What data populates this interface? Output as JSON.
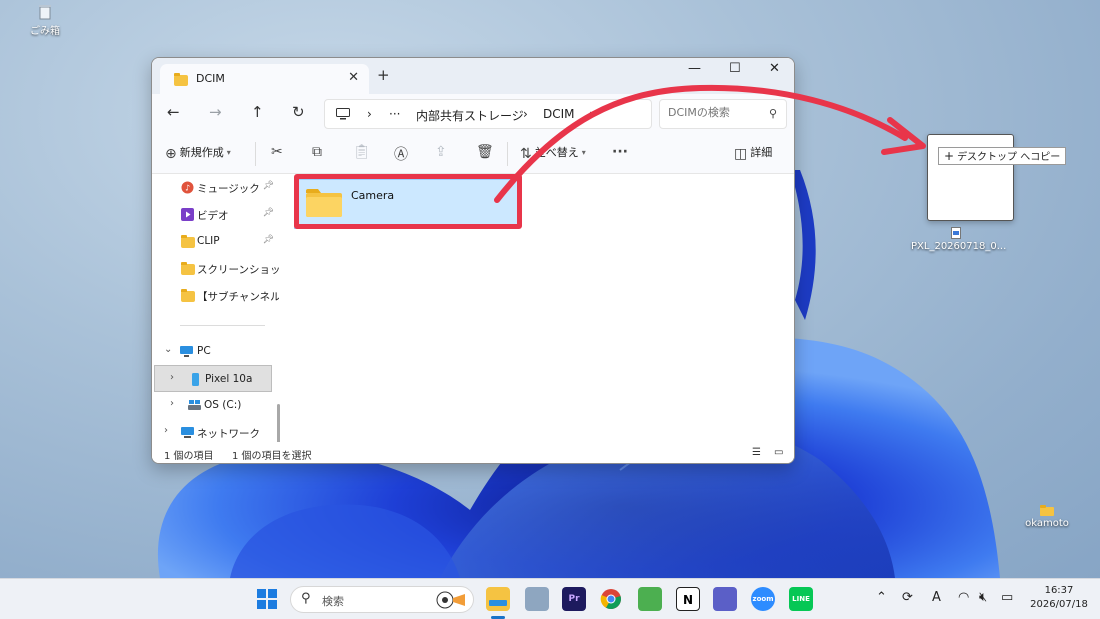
{
  "desktop": {
    "recycle_bin_label": "ごみ箱",
    "drag_file_label": "PXL_20260718_0...",
    "copy_tooltip": "デスクトップ へコピー",
    "folder_label": "okamoto"
  },
  "window": {
    "tab_title": "DCIM",
    "tab_close": "✕",
    "new_tab": "+",
    "minimize": "—",
    "maximize": "☐",
    "close": "✕"
  },
  "nav": {
    "back": "←",
    "forward": "→",
    "up": "↑",
    "refresh": "↻",
    "address": {
      "computer_icon": "monitor-icon",
      "sep": "›",
      "ellipsis": "···",
      "crumbs": [
        "内部共有ストレージ",
        "DCIM"
      ]
    },
    "search_placeholder": "DCIMの検索"
  },
  "toolbar": {
    "new_label": "新規作成",
    "sort_label": "並べ替え",
    "more": "···",
    "details_label": "詳細"
  },
  "sidebar": {
    "quick_access": [
      {
        "label": "ミュージック",
        "icon": "music-icon"
      },
      {
        "label": "ビデオ",
        "icon": "video-icon"
      },
      {
        "label": "CLIP",
        "icon": "folder-icon"
      },
      {
        "label": "スクリーンショット",
        "icon": "folder-icon"
      },
      {
        "label": "【サブチャンネル素材",
        "icon": "folder-icon"
      }
    ],
    "pc_label": "PC",
    "device_label": "Pixel 10a",
    "drive_label": "OS (C:)",
    "network_label": "ネットワーク"
  },
  "content": {
    "folders": [
      {
        "label": "Camera"
      }
    ]
  },
  "status": {
    "item_count": "1 個の項目",
    "selected_count": "1 個の項目を選択"
  },
  "taskbar": {
    "search_label": "検索",
    "apps": [
      "start",
      "search",
      "file-explorer",
      "photos",
      "premiere",
      "chrome",
      "greenshot",
      "notion",
      "teams",
      "zoom",
      "line"
    ],
    "premiere_label": "Pr",
    "notion_label": "N",
    "zoom_label": "zoom",
    "line_label": "LINE",
    "time": "16:37",
    "date": "2026/07/18"
  },
  "colors": {
    "highlight": "#e8354a",
    "selection": "#cce8ff",
    "folder": "#f5c342"
  }
}
